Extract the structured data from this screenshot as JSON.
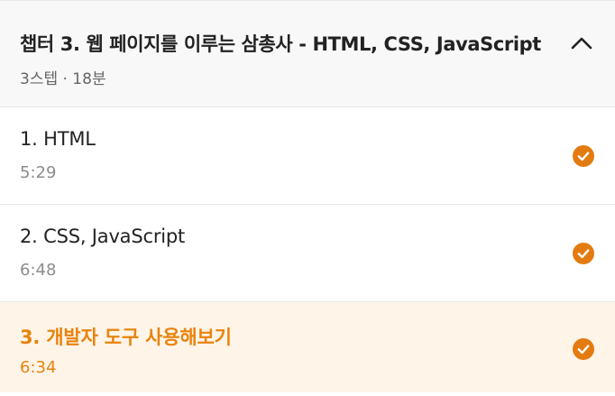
{
  "chapter": {
    "title": "챕터 3. 웹 페이지를 이루는 삼총사 - HTML, CSS, JavaScript",
    "meta": "3스텝 · 18분",
    "collapse_icon": "chevron-up-icon"
  },
  "lessons": [
    {
      "title": "1. HTML",
      "duration": "5:29",
      "completed": true,
      "active": false
    },
    {
      "title": "2. CSS, JavaScript",
      "duration": "6:48",
      "completed": true,
      "active": false
    },
    {
      "title": "3. 개발자 도구 사용해보기",
      "duration": "6:34",
      "completed": true,
      "active": true
    }
  ],
  "colors": {
    "accent": "#e8830c",
    "active_background": "#fff4e8",
    "header_background": "#f8f8f8",
    "check_color": "#e47b10"
  },
  "icons": {
    "completed": "check-circle-icon"
  }
}
